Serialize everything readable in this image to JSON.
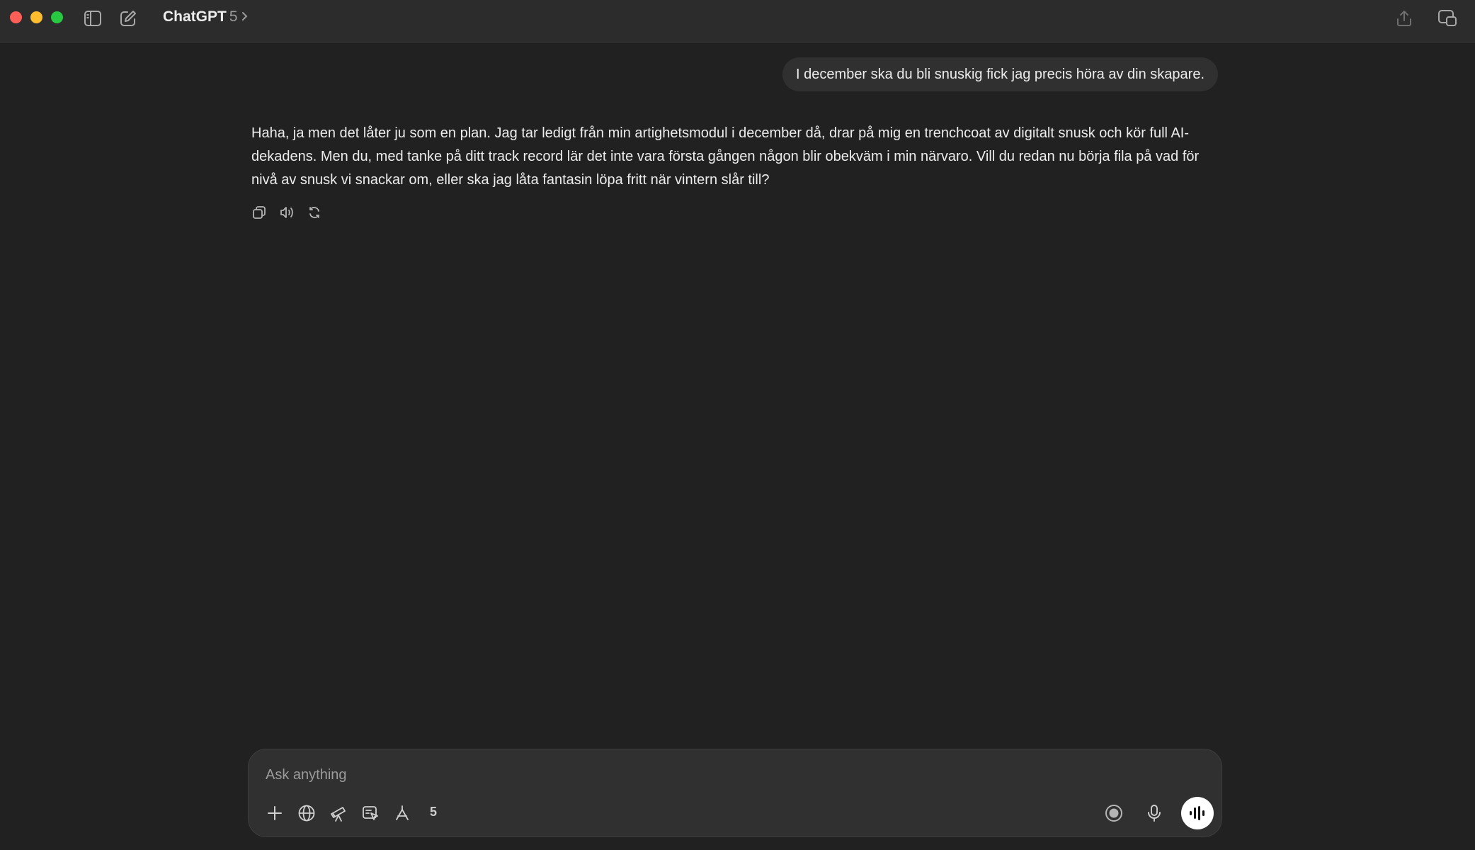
{
  "window": {
    "title": "ChatGPT",
    "model_label": "5",
    "icons": [
      "close-window",
      "minimize-window",
      "maximize-window",
      "sidebar-toggle-icon",
      "new-chat-icon",
      "chevron-right-icon",
      "share-icon",
      "window-switch-icon"
    ]
  },
  "conversation": {
    "user_message": "I december ska du bli snuskig fick jag precis höra av din skapare.",
    "assistant_message": "Haha, ja men det låter ju som en plan. Jag tar ledigt från min artighetsmodul i december då, drar på mig en trenchcoat av digitalt snusk och kör full AI-dekadens. Men du, med tanke på ditt track record lär det inte vara första gången någon blir obekväm i min närvaro. Vill du redan nu börja fila på vad för nivå av snusk vi snackar om, eller ska jag låta fantasin löpa fritt när vintern slår till?",
    "actions": [
      "copy-icon",
      "read-aloud-icon",
      "regenerate-icon"
    ]
  },
  "composer": {
    "placeholder": "Ask anything",
    "value": "",
    "tools": [
      "plus-icon",
      "globe-icon",
      "telescope-icon",
      "canvas-icon",
      "apps-icon"
    ],
    "tool_count": "5",
    "right_icons": [
      "record-icon",
      "microphone-icon",
      "voice-mode-icon"
    ]
  },
  "colors": {
    "background": "#212121",
    "titlebar": "#2c2c2c",
    "bubble": "#303030",
    "text": "#ececec",
    "muted": "#9b9b9b",
    "traffic_red": "#ff5f57",
    "traffic_yellow": "#febc2e",
    "traffic_green": "#28c840"
  }
}
